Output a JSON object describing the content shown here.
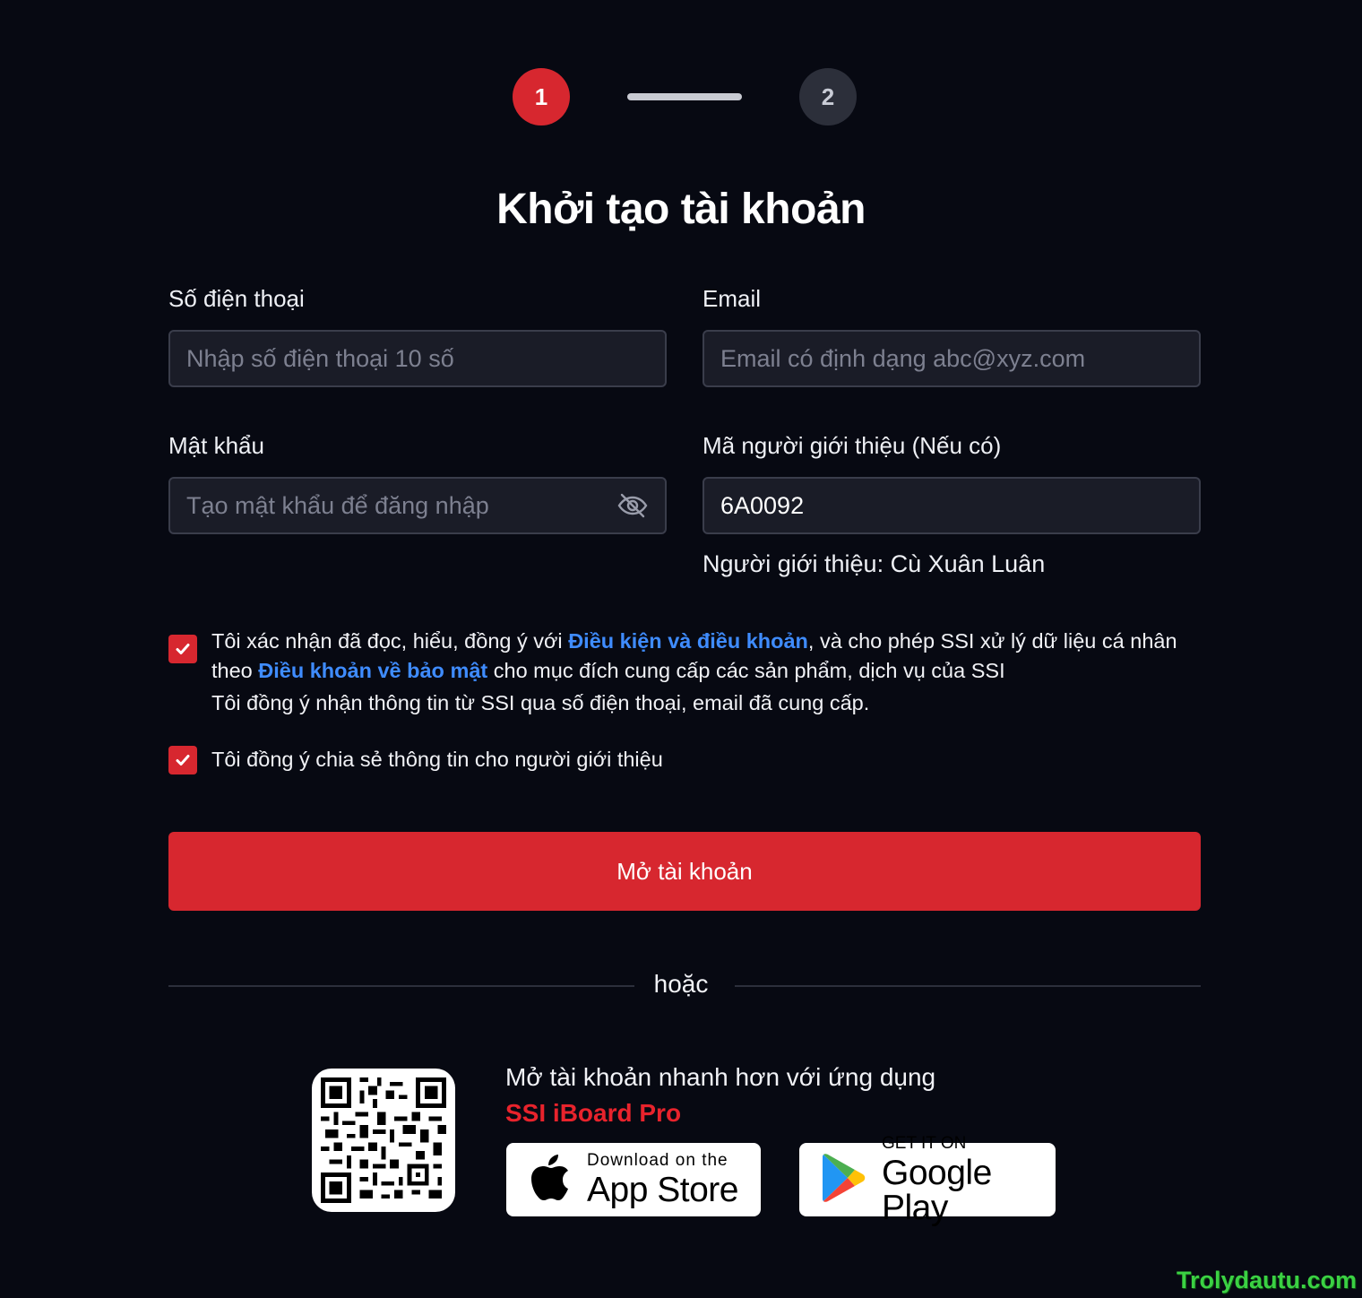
{
  "stepper": {
    "step1": "1",
    "step2": "2",
    "active_color": "#d7272f"
  },
  "title": "Khởi tạo tài khoản",
  "form": {
    "phone": {
      "label": "Số điện thoại",
      "placeholder": "Nhập số điện thoại 10 số",
      "value": ""
    },
    "email": {
      "label": "Email",
      "placeholder": "Email có định dạng abc@xyz.com",
      "value": ""
    },
    "password": {
      "label": "Mật khẩu",
      "placeholder": "Tạo mật khẩu để đăng nhập",
      "value": "",
      "toggle_icon": "eye-off-icon"
    },
    "referral": {
      "label": "Mã người giới thiệu (Nếu có)",
      "placeholder": "",
      "value": "6A0092",
      "note": "Người giới thiệu: Cù Xuân Luân"
    }
  },
  "consent": {
    "terms": {
      "checked": true,
      "text_1": "Tôi xác nhận đã đọc, hiểu, đồng ý với ",
      "link_1": "Điều kiện và điều khoản",
      "text_2": ", và cho phép SSI xử lý dữ liệu cá nhân",
      "text_3": "theo ",
      "link_2": "Điều khoản về bảo mật",
      "text_4": " cho mục đích cung cấp các sản phẩm, dịch vụ của SSI",
      "text_5": "Tôi đồng ý nhận thông tin từ SSI qua số điện thoại, email đã cung cấp."
    },
    "share": {
      "checked": true,
      "text": "Tôi đồng ý chia sẻ thông tin cho người giới thiệu"
    }
  },
  "submit_label": "Mở tài khoản",
  "divider": "hoặc",
  "promo": {
    "text": "Mở tài khoản nhanh hơn với ứng dụng",
    "app_name": "SSI iBoard Pro",
    "app_store": {
      "small": "Download on the",
      "big": "App Store"
    },
    "google_play": {
      "small": "GET IT ON",
      "big": "Google Play"
    }
  },
  "watermark": "Trolydautu.com"
}
